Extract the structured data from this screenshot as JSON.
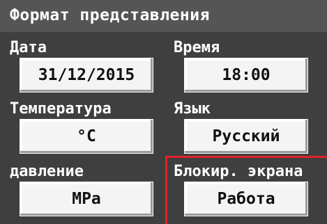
{
  "header": {
    "title": "Формат представления"
  },
  "fields": {
    "date": {
      "label": "Дата",
      "value": "31/12/2015"
    },
    "time": {
      "label": "Время",
      "value": "18:00"
    },
    "temperature": {
      "label": "Температура",
      "value": "°C"
    },
    "language": {
      "label": "Язык",
      "value": "Русский"
    },
    "pressure": {
      "label": "давление",
      "value": "MPa"
    },
    "screen_lock": {
      "label": "Блокир. экрана",
      "value": "Работа"
    }
  },
  "colors": {
    "background": "#3f3f3f",
    "header": "#555555",
    "button": "#f4f4f4",
    "highlight": "#e0222a"
  }
}
